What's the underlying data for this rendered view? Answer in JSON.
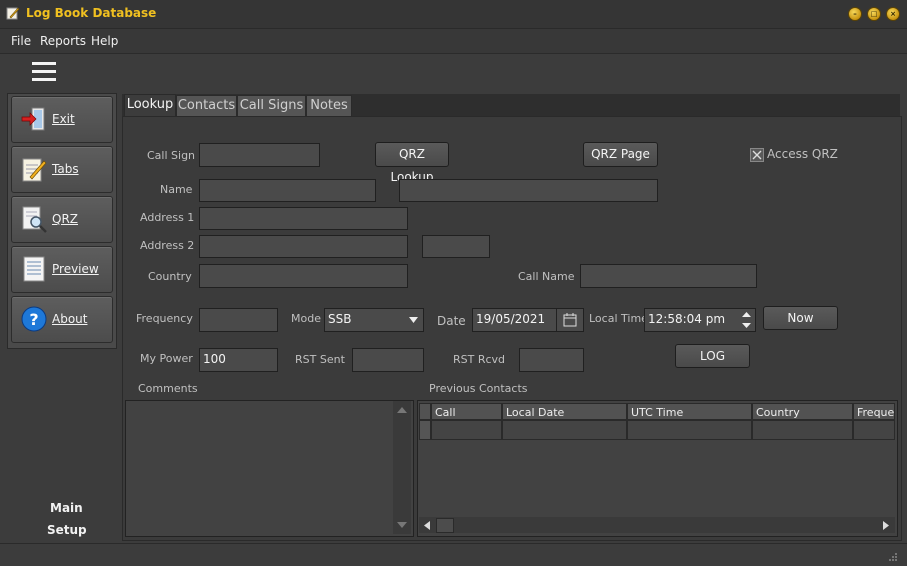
{
  "window": {
    "title": "Log Book Database"
  },
  "menu": {
    "file": "File",
    "reports": "Reports",
    "help": "Help"
  },
  "sidebar": {
    "exit": "Exit",
    "tabs": "Tabs",
    "qrz": "QRZ",
    "preview": "Preview",
    "about": "About",
    "main": "Main",
    "setup": "Setup"
  },
  "tabs": {
    "lookup": "Lookup",
    "contacts": "Contacts",
    "call_signs": "Call Signs",
    "notes": "Notes"
  },
  "form": {
    "call_sign_label": "Call Sign",
    "call_sign_value": "",
    "qrz_lookup": "QRZ Lookup",
    "qrz_page": "QRZ Page",
    "access_qrz": "Access QRZ",
    "name_label": "Name",
    "address1_label": "Address 1",
    "address2_label": "Address 2",
    "country_label": "Country",
    "call_name_label": "Call Name",
    "frequency_label": "Frequency",
    "mode_label": "Mode",
    "mode_value": "SSB",
    "date_label": "Date",
    "date_value": "19/05/2021",
    "local_time_label": "Local Time",
    "local_time_value": "12:58:04 pm",
    "now": "Now",
    "my_power_label": "My Power",
    "my_power_value": "100",
    "rst_sent_label": "RST Sent",
    "rst_rcvd_label": "RST Rcvd",
    "log": "LOG",
    "comments_label": "Comments",
    "previous_contacts_label": "Previous Contacts"
  },
  "grid": {
    "columns": [
      "Call",
      "Local Date",
      "UTC Time",
      "Country",
      "Frequen"
    ]
  }
}
